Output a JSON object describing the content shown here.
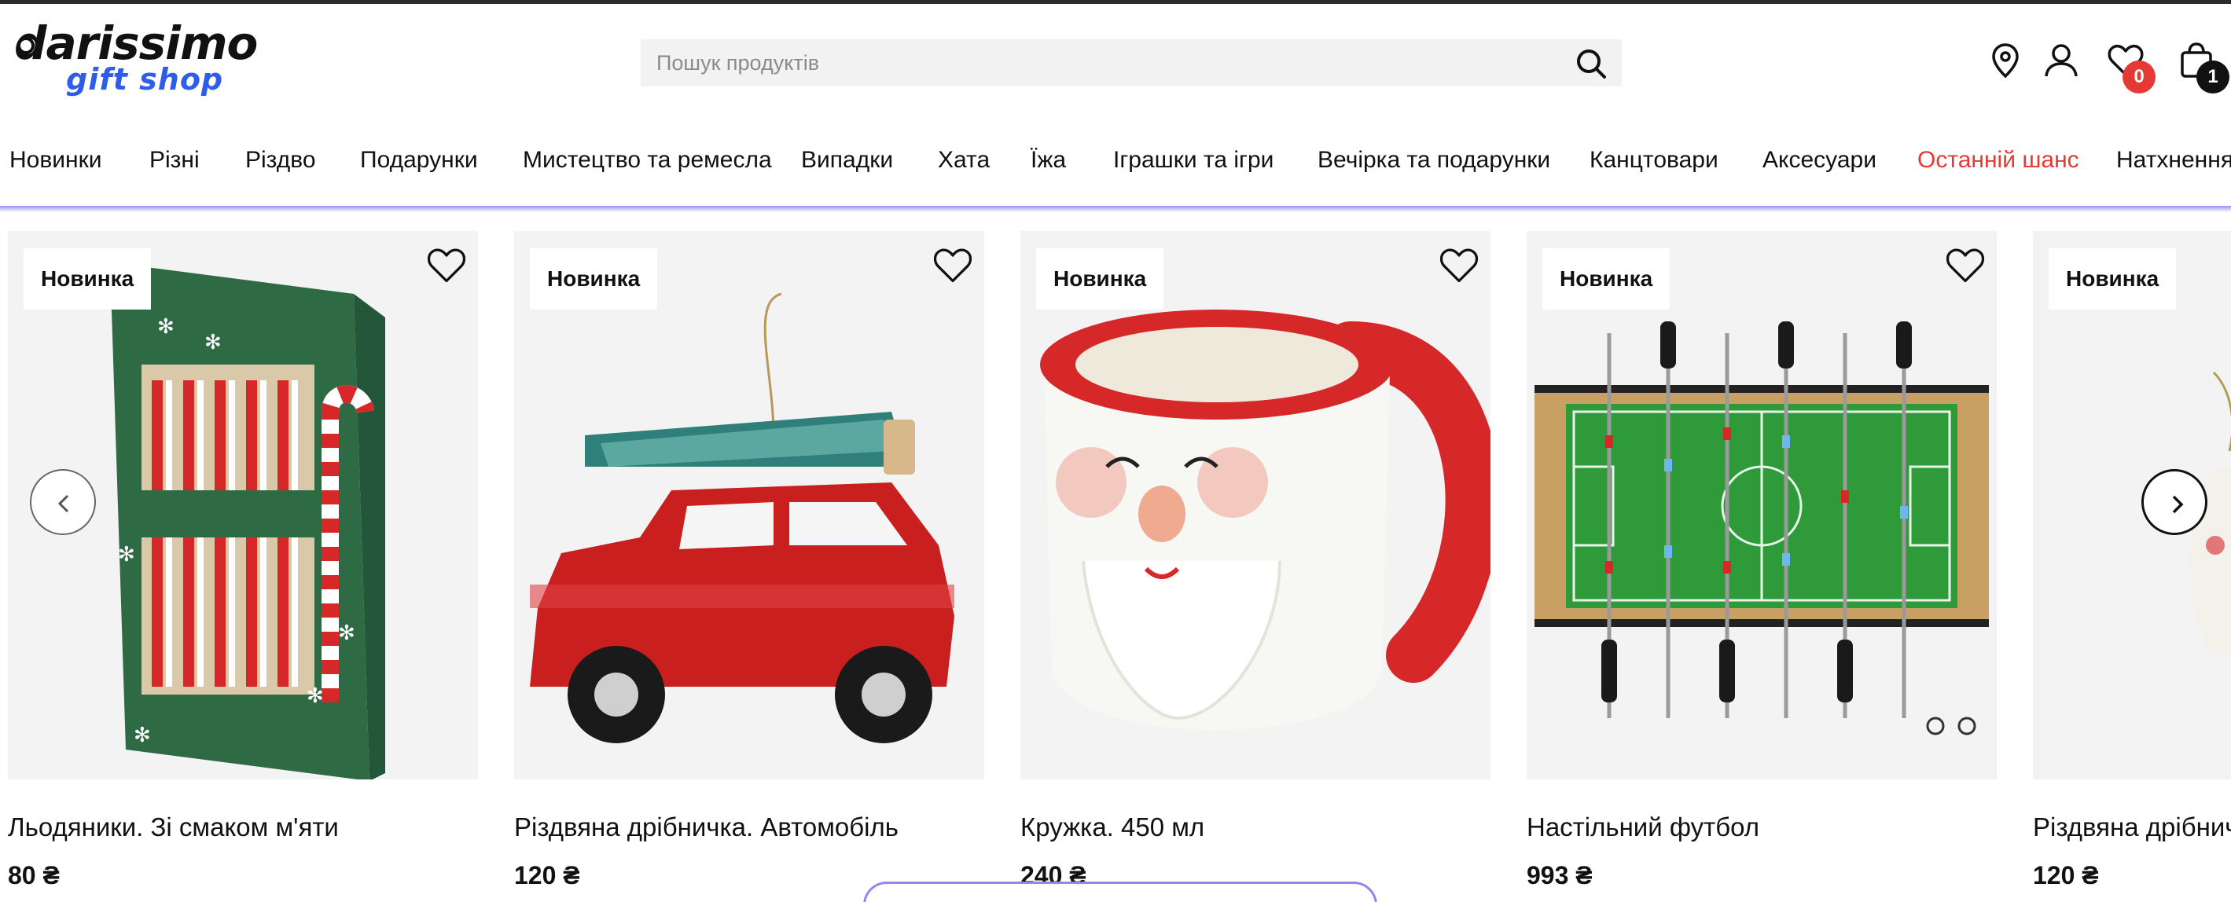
{
  "header": {
    "logo_main": "darissimo",
    "logo_sub": "gift shop",
    "search_placeholder": "Пошук продуктів",
    "wishlist_count": "0",
    "cart_count": "1"
  },
  "nav": {
    "items": [
      {
        "label": "Новинки"
      },
      {
        "label": "Різні"
      },
      {
        "label": "Різдво"
      },
      {
        "label": "Подарунки"
      },
      {
        "label": "Мистецтво та ремесла"
      },
      {
        "label": "Випадки"
      },
      {
        "label": "Хата"
      },
      {
        "label": "Їжа"
      },
      {
        "label": "Іграшки та ігри"
      },
      {
        "label": "Вечірка та подарунки"
      },
      {
        "label": "Канцтовари"
      },
      {
        "label": "Аксесуари"
      },
      {
        "label": "Останній шанс"
      },
      {
        "label": "Натхнення"
      }
    ]
  },
  "products": [
    {
      "tag": "Новинка",
      "title": "Льодяники. Зі смаком м'яти",
      "price": "80 ₴"
    },
    {
      "tag": "Новинка",
      "title": "Різдвяна дрібничка. Автомобіль",
      "price": "120 ₴"
    },
    {
      "tag": "Новинка",
      "title": "Кружка. 450 мл",
      "price": "240 ₴"
    },
    {
      "tag": "Новинка",
      "title": "Настільний футбол",
      "price": "993 ₴"
    },
    {
      "tag": "Новинка",
      "title": "Різдвяна дрібничка",
      "price": "120 ₴"
    }
  ],
  "colors": {
    "accent_red": "#e53935",
    "logo_blue": "#2f5de8",
    "nav_underline": "#8b86f0",
    "card_bg": "#f3f3f3"
  },
  "icons": [
    "search-icon",
    "location-pin-icon",
    "user-icon",
    "heart-icon",
    "shopping-bag-icon",
    "chevron-left-icon",
    "chevron-right-icon"
  ]
}
